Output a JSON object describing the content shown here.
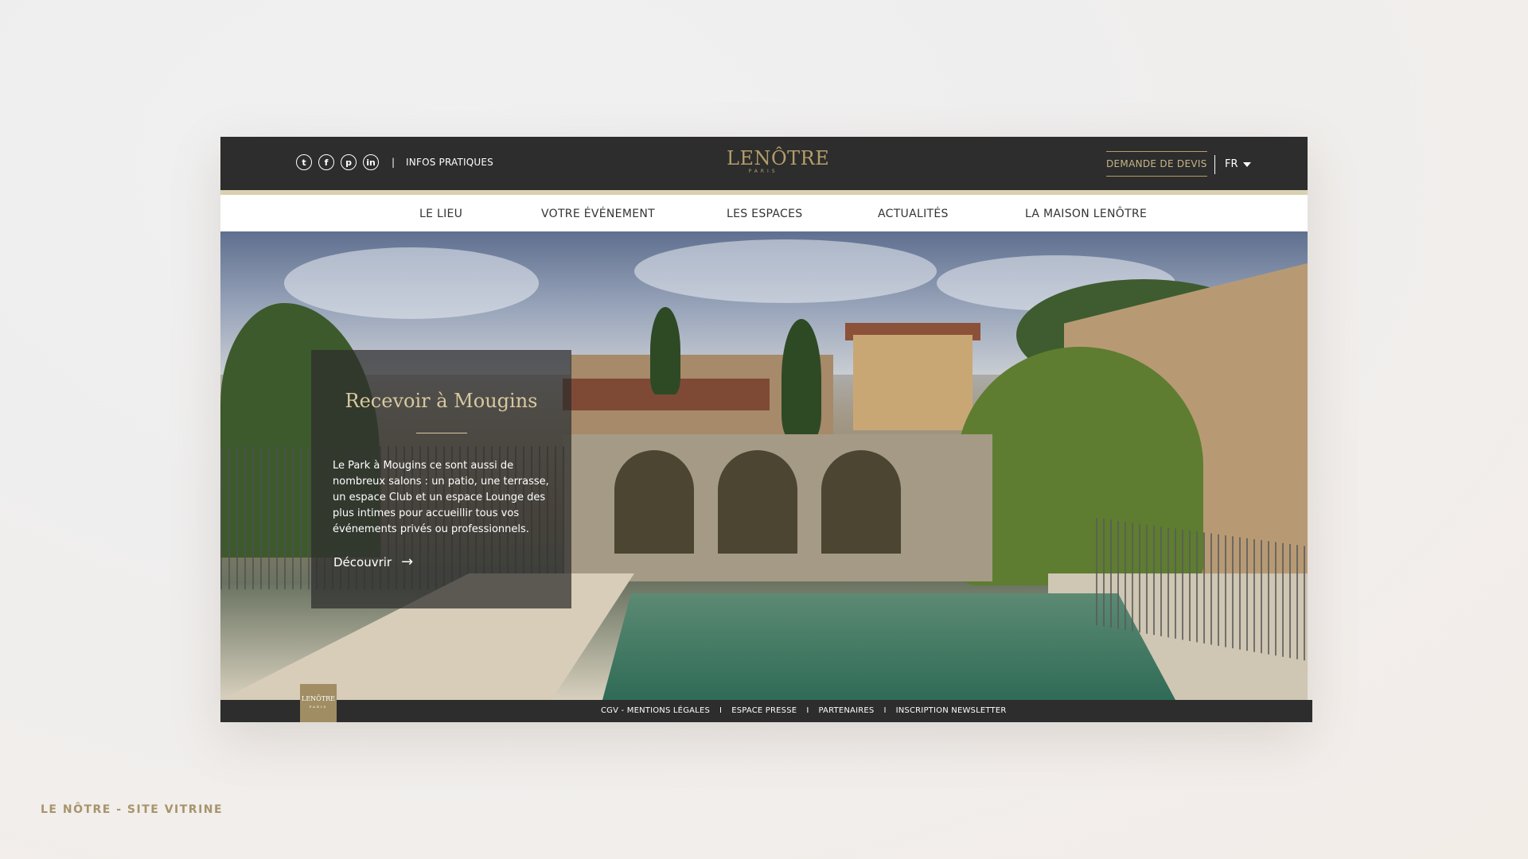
{
  "header": {
    "socials": [
      {
        "icon": "twitter-icon",
        "glyph": "t"
      },
      {
        "icon": "facebook-icon",
        "glyph": "f"
      },
      {
        "icon": "pinterest-icon",
        "glyph": "p"
      },
      {
        "icon": "linkedin-icon",
        "glyph": "in"
      }
    ],
    "infos_label": "INFOS PRATIQUES",
    "logo_text": "LENÔTRE",
    "logo_sub": "PARIS",
    "devis_label": "DEMANDE DE DEVIS",
    "lang_label": "FR"
  },
  "nav": {
    "items": [
      "LE LIEU",
      "VOTRE ÉVÉNEMENT",
      "LES ESPACES",
      "ACTUALITÉS",
      "LA MAISON LENÔTRE"
    ]
  },
  "hero": {
    "title": "Recevoir à Mougins",
    "text": "Le Park à Mougins ce sont aussi de nombreux salons : un patio, une terrasse, un espace Club et un espace Lounge des plus intimes pour accueillir tous vos événements privés ou professionnels.",
    "cta": "Découvrir"
  },
  "footer": {
    "logo_text": "LENÔTRE",
    "logo_sub": "PARIS",
    "links": [
      "CGV - MENTIONS LÉGALES",
      "ESPACE PRESSE",
      "PARTENAIRES",
      "INSCRIPTION NEWSLETTER"
    ],
    "separator": "I"
  },
  "caption": "LE NÔTRE - SITE VITRINE",
  "colors": {
    "gold": "#b59d6a",
    "dark": "#2c2d2c",
    "gold_light": "#d9d0b0"
  }
}
